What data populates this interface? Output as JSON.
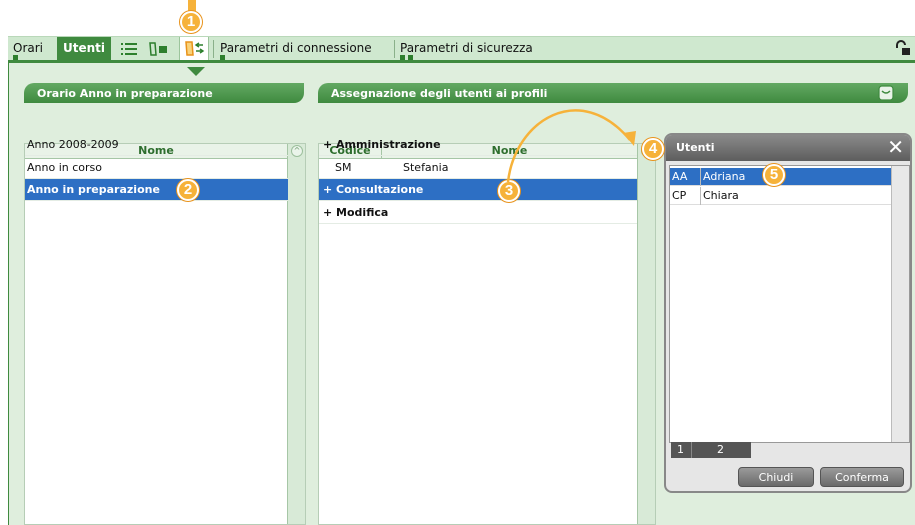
{
  "tabs": [
    {
      "label": "Orari"
    },
    {
      "label": "Utenti"
    },
    {
      "label": "Parametri di connessione"
    },
    {
      "label": "Parametri di sicurezza"
    }
  ],
  "left_panel": {
    "title": "Orario Anno in preparazione",
    "column": "Nome",
    "rows": [
      "Anno 2008-2009",
      "Anno in corso",
      "Anno in preparazione"
    ],
    "selected_index": 2
  },
  "middle_panel": {
    "title": "Assegnazione degli utenti ai profili",
    "columns": {
      "codice": "Codice",
      "nome": "Nome"
    },
    "rows": [
      {
        "codice": "+ Amministrazione",
        "nome": "",
        "group": true
      },
      {
        "codice": "SM",
        "nome": "Stefania",
        "group": false
      },
      {
        "codice": "+ Consultazione",
        "nome": "",
        "group": true,
        "selected": true
      },
      {
        "codice": "+ Modifica",
        "nome": "",
        "group": true
      }
    ]
  },
  "dialog": {
    "title": "Utenti",
    "rows": [
      {
        "code": "AA",
        "name": "Adriana",
        "selected": true
      },
      {
        "code": "CP",
        "name": "Chiara",
        "selected": false
      }
    ],
    "pages": [
      "1",
      "2"
    ],
    "close_label": "Chiudi",
    "confirm_label": "Conferma"
  },
  "callouts": [
    "1",
    "2",
    "3",
    "4",
    "5"
  ],
  "colors": {
    "accent_green": "#3f8a3f",
    "tab_bar": "#cfe8cf",
    "selection_blue": "#2d6fc4",
    "callout_orange": "#f6b23a"
  }
}
